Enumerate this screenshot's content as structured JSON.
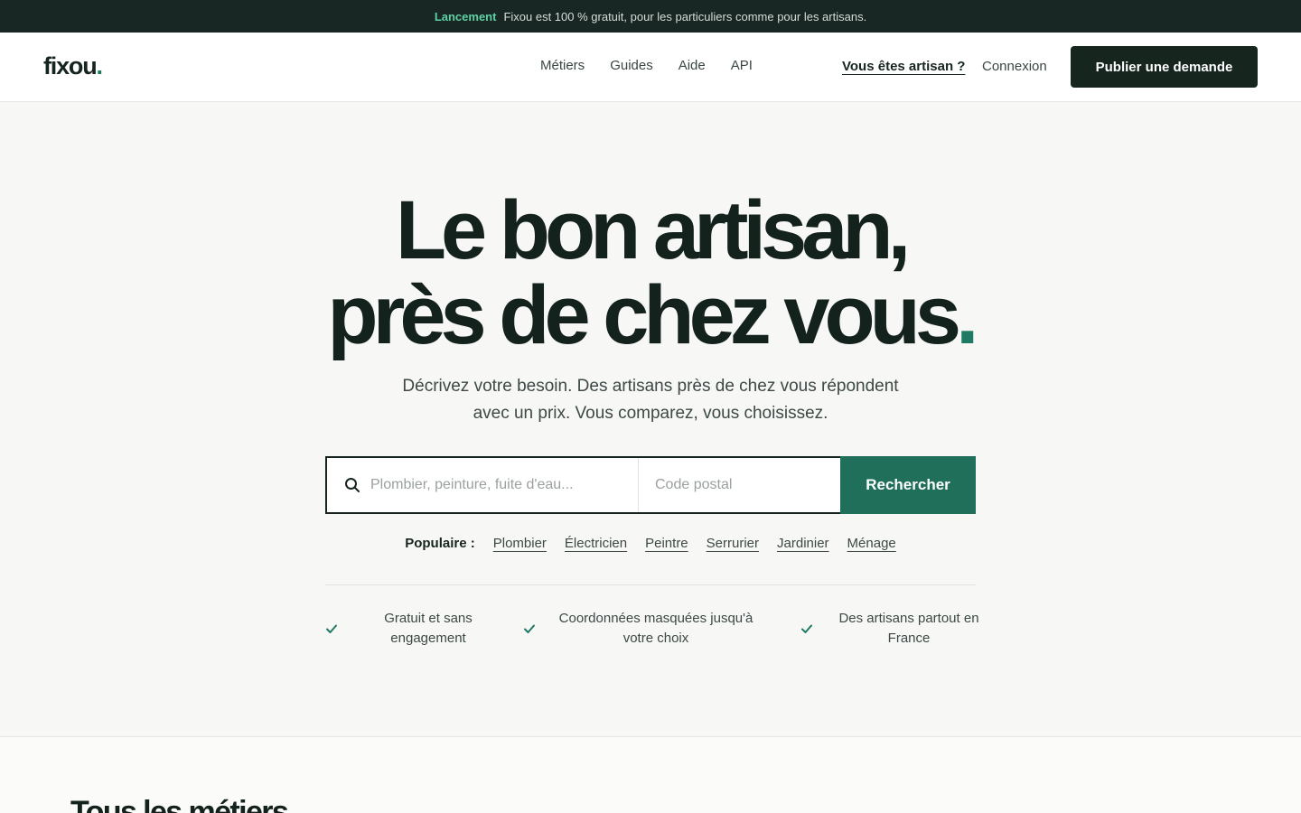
{
  "announcement": {
    "tag": "Lancement",
    "text": "Fixou est 100 % gratuit, pour les particuliers comme pour les artisans."
  },
  "header": {
    "logo_text": "fixou",
    "logo_dot": ".",
    "nav": [
      "Métiers",
      "Guides",
      "Aide",
      "API"
    ],
    "artisan_link": "Vous êtes artisan ?",
    "login_link": "Connexion",
    "cta": "Publier une demande"
  },
  "hero": {
    "title_line1": "Le bon artisan,",
    "title_line2": "près de chez vous",
    "title_dot": ".",
    "subtitle_line1": "Décrivez votre besoin. Des artisans près de chez vous répondent",
    "subtitle_line2": "avec un prix. Vous comparez, vous choisissez."
  },
  "search": {
    "query_placeholder": "Plombier, peinture, fuite d'eau...",
    "postal_placeholder": "Code postal",
    "button": "Rechercher"
  },
  "popular": {
    "label": "Populaire :",
    "items": [
      "Plombier",
      "Électricien",
      "Peintre",
      "Serrurier",
      "Jardinier",
      "Ménage"
    ]
  },
  "features": [
    {
      "line1": "Gratuit et sans",
      "line2": "engagement"
    },
    {
      "line1": "Coordonnées masquées jusqu'à",
      "line2": "votre choix"
    },
    {
      "line1": "Des artisans partout en",
      "line2": "France"
    }
  ],
  "next_section": {
    "title": "Tous les métiers"
  },
  "colors": {
    "accent": "#1f6f5b",
    "dark": "#17251f",
    "announce_bg": "#182723",
    "announce_tag": "#5fd0a5"
  }
}
